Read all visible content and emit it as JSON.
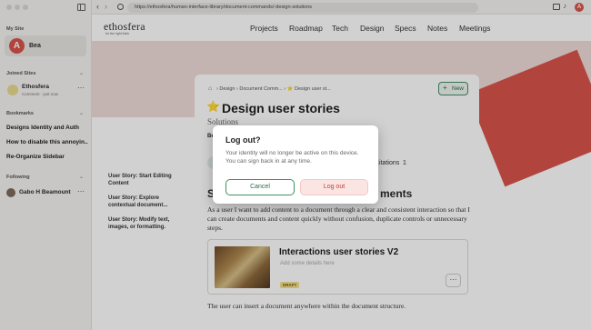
{
  "browser": {
    "url": "https://ethosfera/human-interface-library/document-commands/-design-solutions"
  },
  "sidebar": {
    "my_site_title": "My Site",
    "user_name": "Bea",
    "user_initial": "A",
    "joined_title": "Joined Sites",
    "joined_site": {
      "name": "Ethosfera",
      "sub": "Comment · just now"
    },
    "bookmarks_title": "Bookmarks",
    "bookmarks": [
      "Designs Identity and Auth",
      "How to disable this annoyin...",
      "Re-Organize Sidebar"
    ],
    "following_title": "Following",
    "following": [
      {
        "name": "Gabo H Beamount"
      }
    ]
  },
  "site": {
    "logo": "ethosfera",
    "tagline": "for the right think",
    "nav": [
      "Projects",
      "Roadmap",
      "Tech",
      "Design",
      "Specs",
      "Notes",
      "Meetings"
    ]
  },
  "doc": {
    "breadcrumb": "› Design › Document Comm... › ⭐ Design user st...",
    "new_label": "New",
    "title": "Design user stories",
    "title_emoji": "⭐",
    "subtitle": "Solutions",
    "meta_partial": "Be",
    "citations_label": "Citations",
    "citations_count": "1",
    "heading_left": "S",
    "heading_right": "ments",
    "body": "As a user I want to add content to a document through a clear and consistent interaction so that I can create documents and content quickly without confusion, duplicate controls or unnecessary steps.",
    "embed": {
      "title": "Interactions user stories V2",
      "placeholder": "Add some details here",
      "badge": "DRAFT"
    },
    "footer": "The user can insert a document anywhere within the document structure.",
    "side_stories": [
      "User Story: Start Editing Content",
      "User Story: Explore contextual document...",
      "User Story: Modify text, images, or formatting."
    ]
  },
  "modal": {
    "title": "Log out?",
    "message": "Your identity will no longer be active on this device. You can sign back in at any time.",
    "cancel_label": "Cancel",
    "confirm_label": "Log out"
  },
  "colors": {
    "accent_red": "#d8554c",
    "green": "#3f8f63",
    "badge_yellow": "#f3e08a"
  }
}
